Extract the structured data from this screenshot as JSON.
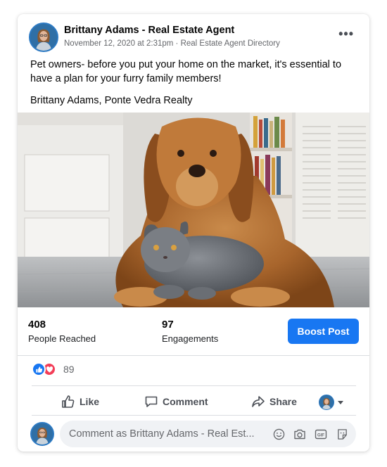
{
  "post": {
    "author": "Brittany Adams - Real Estate Agent",
    "meta": "November 12, 2020 at 2:31pm · Real Estate Agent Directory",
    "more_icon": "more-options-icon",
    "text_line1": "Pet owners- before you put your home on the market, it's essential to have a plan for your furry family members!",
    "text_line2": "Brittany Adams, Ponte Vedra Realty"
  },
  "stats": {
    "reached_value": "408",
    "reached_label": "People Reached",
    "engagements_value": "97",
    "engagements_label": "Engagements",
    "boost_label": "Boost Post"
  },
  "reactions": {
    "count": "89",
    "types": [
      "like-reaction-icon",
      "love-reaction-icon"
    ]
  },
  "actions": {
    "like": "Like",
    "comment": "Comment",
    "share": "Share"
  },
  "comment": {
    "placeholder": "Comment as Brittany Adams - Real Est...",
    "icons": [
      "emoji-icon",
      "camera-icon",
      "gif-icon",
      "sticker-icon"
    ]
  },
  "colors": {
    "accent": "#1877f2",
    "love": "#f33e58",
    "muted_text": "#65676b"
  }
}
